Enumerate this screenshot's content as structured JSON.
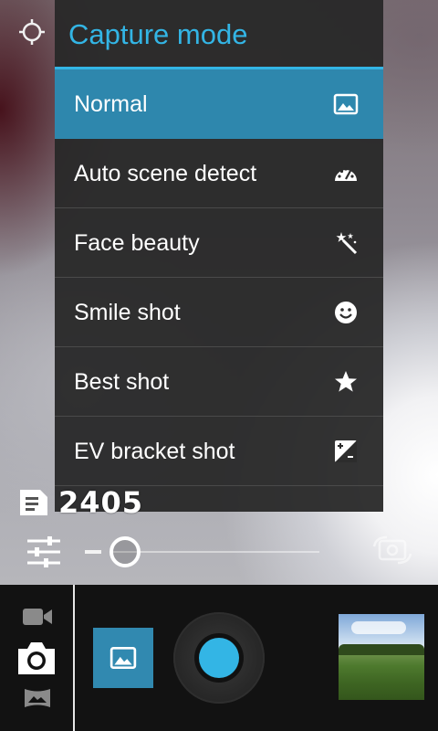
{
  "menu": {
    "title": "Capture mode",
    "items": [
      {
        "label": "Normal",
        "icon": "landscape-icon",
        "selected": true
      },
      {
        "label": "Auto scene detect",
        "icon": "speedometer-icon",
        "selected": false
      },
      {
        "label": "Face beauty",
        "icon": "magic-wand-icon",
        "selected": false
      },
      {
        "label": "Smile shot",
        "icon": "smiley-icon",
        "selected": false
      },
      {
        "label": "Best shot",
        "icon": "star-icon",
        "selected": false
      },
      {
        "label": "EV bracket shot",
        "icon": "exposure-icon",
        "selected": false
      }
    ]
  },
  "status": {
    "remaining_shots": "2405",
    "storage_icon": "sd-card-icon"
  },
  "zoom": {
    "level": 0.0,
    "minus_icon": "zoom-minus-icon"
  },
  "colors": {
    "accent": "#33b5e5",
    "selected_bg": "#2e87ad",
    "menu_bg": "#282828"
  },
  "controls": {
    "modes": [
      "video-camera-icon",
      "camera-icon",
      "panorama-icon"
    ],
    "current_mode_icon": "landscape-icon",
    "shutter_icon": "shutter-icon",
    "thumbnail": "last-photo-thumbnail"
  }
}
